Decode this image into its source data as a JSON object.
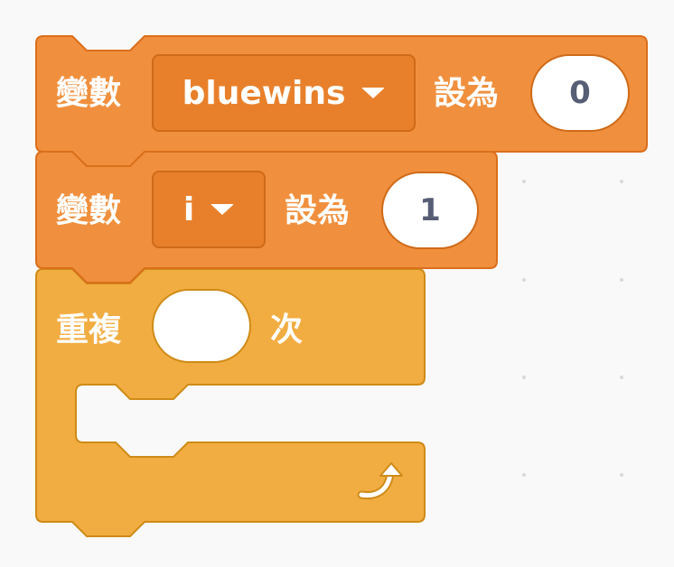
{
  "blocks": {
    "set_var_1": {
      "label": "變數",
      "variable": "bluewins",
      "to_label": "設為",
      "value": "0"
    },
    "set_var_2": {
      "label": "變數",
      "variable": "i",
      "to_label": "設為",
      "value": "1"
    },
    "repeat": {
      "label": "重複",
      "times": "",
      "suffix": "次"
    }
  },
  "icons": {
    "dropdown": "caret-down-icon",
    "loop": "loop-arrow-icon"
  },
  "colors": {
    "variables_block": "#f0903e",
    "variables_border": "#db6e1c",
    "control_block": "#f2ad42",
    "control_border": "#cf8b17",
    "input_text": "#575e75",
    "workspace": "#f9f9f9"
  }
}
